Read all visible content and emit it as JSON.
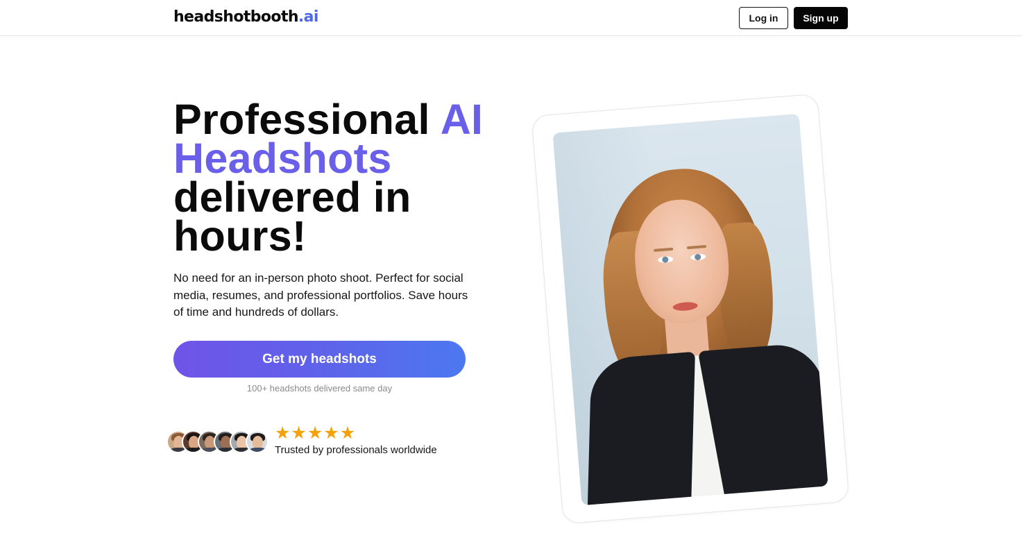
{
  "header": {
    "logo_main": "headshotbooth",
    "logo_tld": ".ai",
    "login_label": "Log in",
    "signup_label": "Sign up"
  },
  "hero": {
    "title_part1": "Professional ",
    "title_accent1": "AI",
    "title_accent2": "Headshots",
    "title_part2": "delivered in hours!",
    "subtitle": "No need for an in-person photo shoot. Perfect for social media, resumes, and professional portfolios. Save hours of time and hundreds of dollars.",
    "cta_label": "Get my headshots",
    "cta_note": "100+ headshots delivered same day"
  },
  "social_proof": {
    "rating": 5,
    "rating_max": 5,
    "star_glyph": "★",
    "trust_text": "Trusted by professionals worldwide",
    "avatars": [
      "avatar-1",
      "avatar-2",
      "avatar-3",
      "avatar-4",
      "avatar-5",
      "avatar-6"
    ]
  },
  "colors": {
    "accent_purple": "#6b5ae6",
    "logo_tld_blue": "#4f6ae8",
    "cta_gradient_start": "#6f54e8",
    "cta_gradient_end": "#4c78f0",
    "star": "#f5a20a",
    "signup_bg": "#050505"
  },
  "icons": {
    "star": "star-icon"
  }
}
